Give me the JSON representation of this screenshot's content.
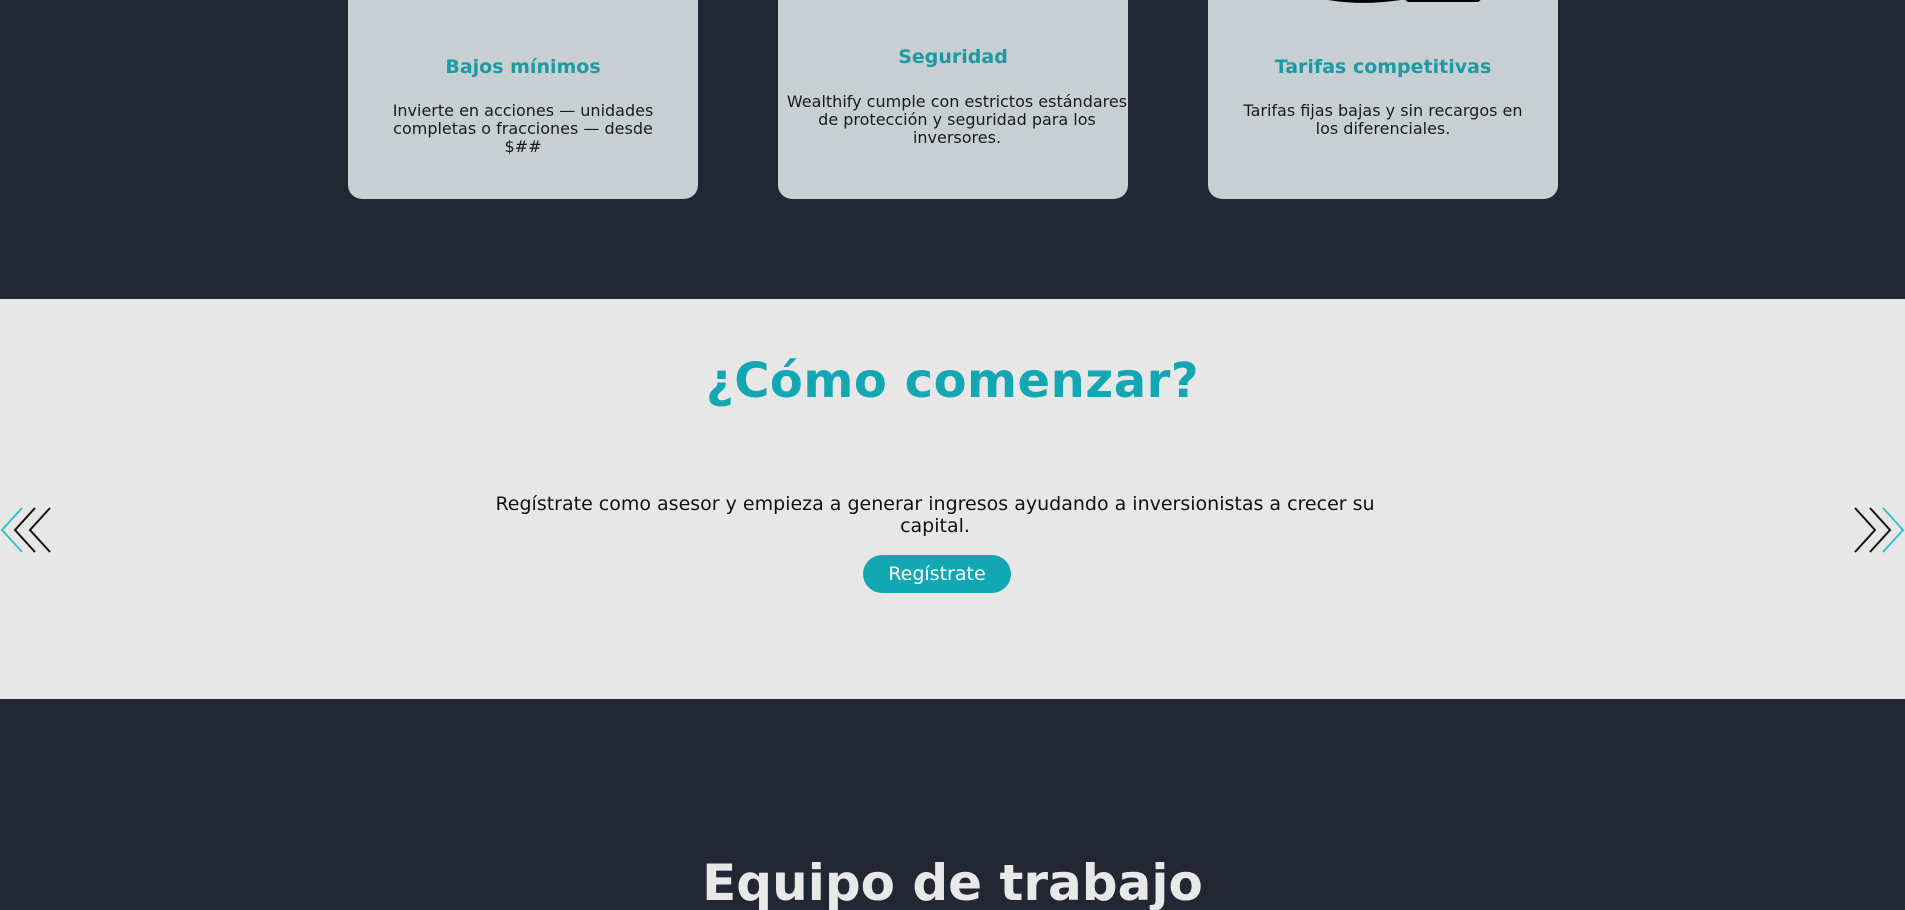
{
  "features": {
    "cards": [
      {
        "title": "Bajos mínimos",
        "desc": "Invierte en acciones — unidades completas o fracciones — desde $##"
      },
      {
        "title": "Seguridad",
        "desc": "Wealthify cumple con estrictos estándares de protección y seguridad para los inversores."
      },
      {
        "title": "Tarifas competitivas",
        "desc": "Tarifas fijas bajas y sin recargos en los diferenciales."
      }
    ]
  },
  "howto": {
    "title": "¿Cómo comenzar?",
    "text": "Regístrate como asesor y empieza a generar ingresos ayudando a inversionistas a crecer su capital.",
    "button_label": "Regístrate"
  },
  "team": {
    "title": "Equipo de trabajo"
  },
  "colors": {
    "accent": "#12a7b2",
    "dark_bg": "#232733",
    "light_bg": "#e7e7e7",
    "card_bg": "#c8cfd2"
  }
}
